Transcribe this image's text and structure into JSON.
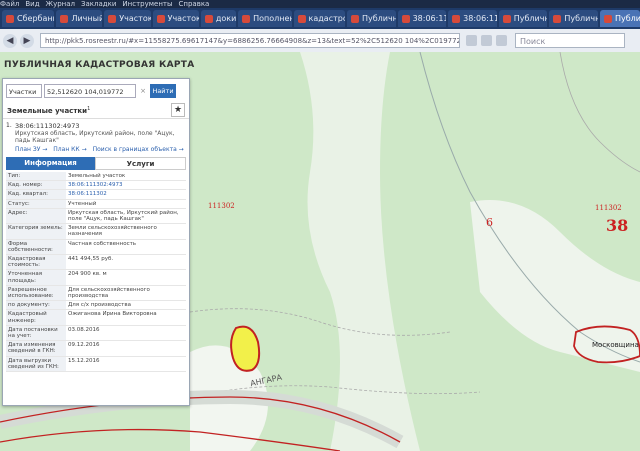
{
  "menubar": [
    "Файл",
    "Вид",
    "Журнал",
    "Закладки",
    "Инструменты",
    "Справка"
  ],
  "tabs": [
    {
      "label": "Сбербанк"
    },
    {
      "label": "Личный"
    },
    {
      "label": "Участок"
    },
    {
      "label": "Участок"
    },
    {
      "label": "доки"
    },
    {
      "label": "Пополнен"
    },
    {
      "label": "кадастро"
    },
    {
      "label": "Публичн"
    },
    {
      "label": "38:06:11"
    },
    {
      "label": "38:06:11"
    },
    {
      "label": "Публичн"
    },
    {
      "label": "Публичн"
    },
    {
      "label": "Публи",
      "active": true
    }
  ],
  "address": {
    "url": "http://pkk5.rosreestr.ru/#x=11558275.69617147&y=6886256.76664908&z=13&text=52%2C512620 104%2C019772&type=1&app=search&opened=1",
    "search_placeholder": "Поиск"
  },
  "map": {
    "title": "ПУБЛИЧНАЯ КАДАСТРОВАЯ КАРТА",
    "labels": {
      "quarter_left": "111302",
      "quarter_right": "111302",
      "six": "6",
      "thirty_eight": "38",
      "village": "Московщина",
      "river": "АНГАРА"
    },
    "colors": {
      "forest": "#cfe8c8",
      "boundary": "#c22222",
      "parcel_fill": "#f2f04a"
    }
  },
  "panel": {
    "search_type": "Участки",
    "search_value": "52,512620 104,019772",
    "search_button": "Найти",
    "section_title": "Земельные участки",
    "count": "1",
    "result": {
      "index": "1.",
      "number": "38:06:111302:4973",
      "address": "Иркутская область, Иркутский район, поле \"Ацук, падь Кашгак\"",
      "links": [
        "План ЗУ →",
        "План КК →",
        "Поиск в границах объекта →"
      ]
    },
    "tab_info": "Информация",
    "tab_services": "Услуги",
    "rows": [
      {
        "k": "Тип:",
        "v": "Земельный участок"
      },
      {
        "k": "Кад. номер:",
        "v": "38:06:111302:4973",
        "link": true
      },
      {
        "k": "Кад. квартал:",
        "v": "38:06:111302",
        "link": true
      },
      {
        "k": "Статус:",
        "v": "Учтенный"
      },
      {
        "k": "Адрес:",
        "v": "Иркутская область, Иркутский район, поле \"Ацук, падь Кашгак\""
      },
      {
        "k": "Категория земель:",
        "v": "Земли сельскохозяйственного назначения"
      },
      {
        "k": "Форма собственности:",
        "v": "Частная собственность"
      },
      {
        "k": "Кадастровая стоимость:",
        "v": "441 494,55 руб."
      },
      {
        "k": "Уточненная площадь:",
        "v": "204 900 кв. м"
      },
      {
        "k": "Разрешенное использование:",
        "v": "Для сельскохозяйственного производства"
      },
      {
        "k": "по документу:",
        "v": "Для с/х производства"
      },
      {
        "k": "Кадастровый инженер:",
        "v": "Ожиганова Ирина Викторовна"
      },
      {
        "k": "Дата постановки на учет:",
        "v": "03.08.2016"
      },
      {
        "k": "Дата изменения сведений в ГКН:",
        "v": "09.12.2016"
      },
      {
        "k": "Дата выгрузки сведений из ГКН:",
        "v": "15.12.2016"
      }
    ]
  }
}
